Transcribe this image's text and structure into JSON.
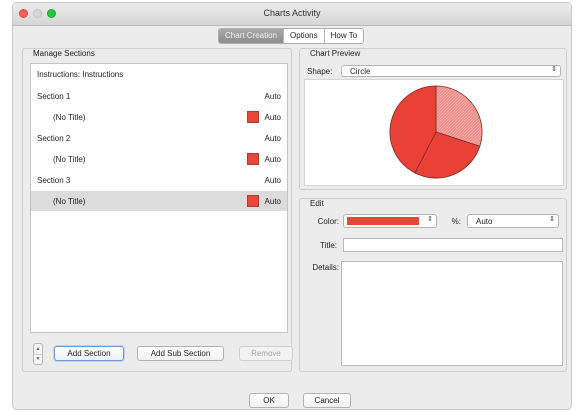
{
  "window": {
    "title": "Charts Activity"
  },
  "tabs": [
    {
      "label": "Chart Creation",
      "active": true
    },
    {
      "label": "Options",
      "active": false
    },
    {
      "label": "How To",
      "active": false
    }
  ],
  "manage_sections": {
    "label": "Manage Sections",
    "rows": [
      {
        "label": "Instructions: Instructions",
        "auto": ""
      },
      {
        "label": "Section 1",
        "auto": "Auto"
      },
      {
        "label": "(No Title)",
        "auto": "Auto",
        "swatch": "#e8473c"
      },
      {
        "label": "Section 2",
        "auto": "Auto"
      },
      {
        "label": "(No Title)",
        "auto": "Auto",
        "swatch": "#e8473c"
      },
      {
        "label": "Section 3",
        "auto": "Auto"
      },
      {
        "label": "(No Title)",
        "auto": "Auto",
        "swatch": "#e8473c",
        "selected": true
      }
    ],
    "buttons": {
      "add_section": "Add Section",
      "add_sub_section": "Add Sub Section",
      "remove": "Remove"
    }
  },
  "chart_preview": {
    "label": "Chart Preview",
    "shape_label": "Shape:",
    "shape_value": "Circle",
    "slice_colors": [
      "#f08d87",
      "#ea4136",
      "#ea4136"
    ]
  },
  "edit": {
    "label": "Edit",
    "color_label": "Color:",
    "color_value": "#e8473c",
    "percent_label": "%:",
    "percent_value": "Auto",
    "title_label": "Title:",
    "title_value": "",
    "details_label": "Details:",
    "details_value": ""
  },
  "footer": {
    "ok": "OK",
    "cancel": "Cancel"
  },
  "icons": {
    "close": "close-window-icon",
    "minimize": "minimize-window-icon",
    "maximize": "maximize-window-icon",
    "select_arrows": "up-down-arrows-icon",
    "stepper": "stepper-icon"
  }
}
